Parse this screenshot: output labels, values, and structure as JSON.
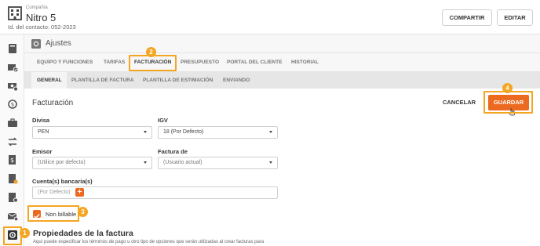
{
  "header": {
    "kicker": "Compañía",
    "company_name": "Nitro 5",
    "contact_id": "Id. del contacto: 052-2023",
    "share_label": "COMPARTIR",
    "edit_label": "EDITAR"
  },
  "sidebar": {
    "items": [
      {
        "icon": "book-icon"
      },
      {
        "icon": "check-envelope-icon"
      },
      {
        "icon": "money-check-icon"
      },
      {
        "icon": "money-refresh-icon"
      },
      {
        "icon": "briefcase-icon"
      },
      {
        "icon": "transfer-arrows-icon"
      },
      {
        "icon": "dollar-document-icon"
      },
      {
        "icon": "document-badge-icon"
      },
      {
        "icon": "document-edit-icon"
      },
      {
        "icon": "mail-settings-icon"
      },
      {
        "icon": "gear-icon",
        "active": true
      }
    ]
  },
  "panel": {
    "title": "Ajustes"
  },
  "tabs": [
    {
      "label": "EQUIPO Y FUNCIONES"
    },
    {
      "label": "TARIFAS"
    },
    {
      "label": "FACTURACIÓN",
      "active": true
    },
    {
      "label": "PRESUPUESTO"
    },
    {
      "label": "PORTAL DEL CLIENTE"
    },
    {
      "label": "HISTORIAL"
    }
  ],
  "subtabs": [
    {
      "label": "GENERAL",
      "active": true
    },
    {
      "label": "PLANTILLA DE FACTURA"
    },
    {
      "label": "PLANTILLA DE ESTIMACIÓN"
    },
    {
      "label": "ENVIANDO"
    }
  ],
  "form": {
    "title": "Facturación",
    "cancel_label": "CANCELAR",
    "save_label": "GUARDAR",
    "currency_label": "Divisa",
    "currency_value": "PEN",
    "igv_label": "IGV",
    "igv_value": "18 (Por Defecto)",
    "issuer_label": "Emisor",
    "issuer_value": "(Utilice por defecto)",
    "invoice_from_label": "Factura de",
    "invoice_from_value": "(Usuario actual)",
    "bank_accounts_label": "Cuenta(s) bancaria(s)",
    "bank_accounts_placeholder": "(Por Defecto)",
    "non_billable_label": "Non billable",
    "non_billable_checked": true
  },
  "section": {
    "title": "Propiedades de la factura",
    "description": "Aquí puede especificar los términos de pago u otro tipo de opciones que serán utilizadas al crear facturas para"
  },
  "annotations": {
    "badges": [
      "1",
      "2",
      "3",
      "4"
    ],
    "highlight_color": "#f4a623"
  },
  "colors": {
    "accent": "#ec6a1f"
  }
}
